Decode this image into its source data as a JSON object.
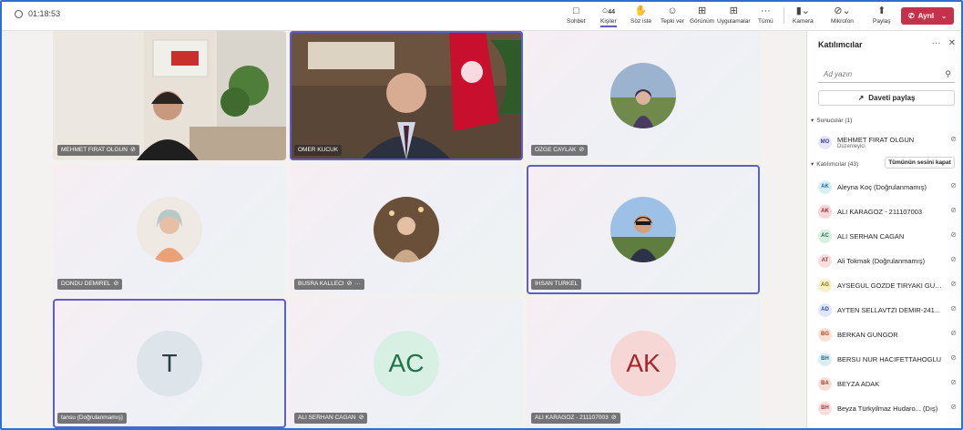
{
  "meeting": {
    "elapsed": "01:18:53"
  },
  "toolbar": {
    "chat": "Sohbet",
    "people": "Kişiler",
    "people_count": "44",
    "raise": "Söz iste",
    "react": "Tepki ver",
    "view": "Görünüm",
    "apps": "Uygulamalar",
    "more": "Tümü",
    "camera": "Kamera",
    "mic": "Mikrofon",
    "share": "Paylaş",
    "leave": "Ayrıl"
  },
  "tiles": [
    {
      "name": "MEHMET FIRAT OLGUN",
      "type": "video1"
    },
    {
      "name": "OMER KUCUK",
      "type": "video2",
      "speaking": true
    },
    {
      "name": "OZGE CAYLAK",
      "type": "photo"
    },
    {
      "name": "DONDU DEMIREL",
      "type": "photo"
    },
    {
      "name": "BUSRA KALLECI",
      "type": "photo",
      "more": "···"
    },
    {
      "name": "IHSAN TURKEL",
      "type": "photo",
      "speaking": true
    },
    {
      "name": "tansu (Doğrulanmamış)",
      "type": "initials",
      "initials": "T",
      "speaking": true
    },
    {
      "name": "ALI SERHAN CAGAN",
      "type": "initials",
      "initials": "AC"
    },
    {
      "name": "ALI KARAGOZ - 211107003",
      "type": "initials",
      "initials": "AK"
    }
  ],
  "panel": {
    "title": "Katılımcılar",
    "search_placeholder": "Ad yazın",
    "invite": "Daveti paylaş",
    "presenters_header": "Sunucular (1)",
    "attendees_header": "Katılımcılar (43)",
    "mute_all": "Tümünün sesini kapat",
    "presenter": {
      "initials": "MO",
      "name": "MEHMET FIRAT OLGUN",
      "role": "Düzenleyici"
    },
    "attendees": [
      {
        "initials": "AK",
        "name": "Aleyna Koç (Doğrulanmamış)",
        "color": "#d6eef6",
        "fg": "#1b6a85"
      },
      {
        "initials": "AK",
        "name": "ALI KARAGOZ - 211107003",
        "color": "#f6d7d5",
        "fg": "#a4262c"
      },
      {
        "initials": "AC",
        "name": "ALI SERHAN CAGAN",
        "color": "#d8f0e4",
        "fg": "#217346"
      },
      {
        "initials": "AT",
        "name": "Ali Tokmak (Doğrulanmamış)",
        "color": "#f9dede",
        "fg": "#b33a3a"
      },
      {
        "initials": "AG",
        "name": "AYSEGUL GOZDE TIRYAKI GUN...",
        "color": "#fbf1c9",
        "fg": "#8a6d00"
      },
      {
        "initials": "AD",
        "name": "AYTEN SELLAVTZI DEMIR-241...",
        "color": "#dfe6f7",
        "fg": "#2b4f9e"
      },
      {
        "initials": "BG",
        "name": "BERKAN GUNGOR",
        "color": "#fbe0d6",
        "fg": "#a14a1e"
      },
      {
        "initials": "BH",
        "name": "BERSU NUR HACIFETTAHOGLU",
        "color": "#dceef5",
        "fg": "#1b6a85"
      },
      {
        "initials": "BA",
        "name": "BEYZA ADAK",
        "color": "#f7dfd9",
        "fg": "#9a3b2a"
      },
      {
        "initials": "BH",
        "name": "Beyza Türkyilmaz Hudaro... (Dış)",
        "color": "#f9dede",
        "fg": "#b33a3a"
      }
    ]
  },
  "colors": {
    "accent": "#5b5fc7",
    "leave": "#c4314b",
    "frame": "#2f6fd1"
  }
}
